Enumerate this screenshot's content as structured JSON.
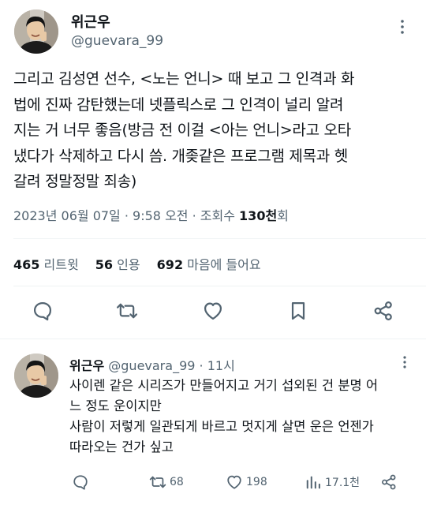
{
  "main_tweet": {
    "author_name": "위근우",
    "author_handle": "@guevara_99",
    "text_lines": [
      "그리고 김성연 선수, <노는 언니> 때 보고 그 인격과 화",
      "법에 진짜 감탄했는데 넷플릭스로 그 인격이 널리 알려",
      "지는 거 너무 좋음(방금 전 이걸 <아는 언니>라고 오타",
      "냈다가 삭제하고 다시 씀. 개좆같은 프로그램 제목과 헷",
      "갈려 정말정말 죄송)"
    ],
    "date": "2023년 06월 07일",
    "time": "9:58 오전",
    "views_label": "조회수",
    "views_count": "130천",
    "views_suffix": "회",
    "stats": {
      "retweets_count": "465",
      "retweets_label": "리트윗",
      "quotes_count": "56",
      "quotes_label": "인용",
      "likes_count": "692",
      "likes_label": "마음에 들어요"
    },
    "icons": [
      "reply-icon",
      "retweet-icon",
      "like-icon",
      "bookmark-icon",
      "share-icon"
    ]
  },
  "reply_tweet": {
    "author_name": "위근우",
    "author_handle": "@guevara_99",
    "time": "11시",
    "text_lines": [
      "사이렌 같은 시리즈가 만들어지고 거기 섭외된 건 분명 어",
      "느 정도 운이지만",
      "사람이 저렇게 일관되게 바르고 멋지게 살면 운은 언젠가",
      "따라오는 건가 싶고"
    ],
    "actions": {
      "reply_count": "",
      "retweet_count": "68",
      "like_count": "198",
      "views_count": "17.1천"
    }
  },
  "colors": {
    "text_primary": "#0f1419",
    "text_secondary": "#536471",
    "divider": "#eff3f4"
  }
}
